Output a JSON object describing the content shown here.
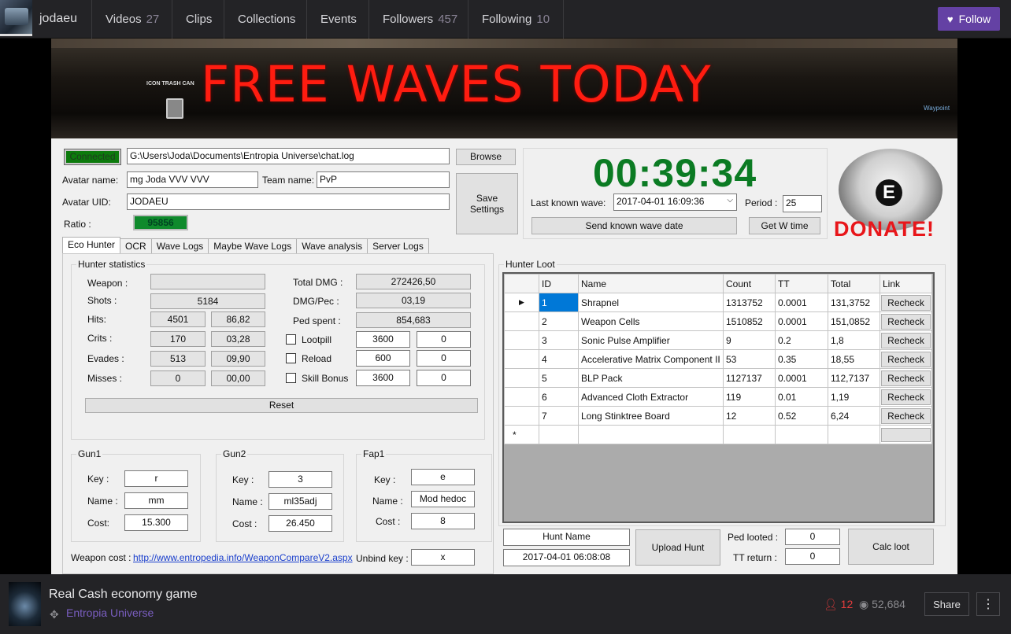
{
  "topbar": {
    "channel": "jodaeu",
    "nav": [
      {
        "label": "Videos",
        "count": "27"
      },
      {
        "label": "Clips",
        "count": ""
      },
      {
        "label": "Collections",
        "count": ""
      },
      {
        "label": "Events",
        "count": ""
      },
      {
        "label": "Followers",
        "count": "457"
      },
      {
        "label": "Following",
        "count": "10"
      }
    ],
    "follow_label": "Follow",
    "accent": "#6441a4"
  },
  "banner": {
    "text": "FREE WAVES TODAY",
    "trash_label": "ICON TRASH CAN",
    "waypoint": "Waypoint"
  },
  "app": {
    "status": "Connected",
    "chat_log_path": "G:\\Users\\Joda\\Documents\\Entropia Universe\\chat.log",
    "browse": "Browse",
    "avatar_name_label": "Avatar name:",
    "avatar_name": "mg Joda VVV VVV",
    "team_name_label": "Team name:",
    "team_name": "PvP",
    "avatar_uid_label": "Avatar UID:",
    "avatar_uid": "JODAEU",
    "ratio_label": "Ratio :",
    "ratio": "95856",
    "save_settings": "Save Settings",
    "timer": "00:39:34",
    "last_wave_label": "Last known wave:",
    "last_wave": "2017-04-01 16:09:36",
    "period_label": "Period :",
    "period": "25",
    "send_wave": "Send known wave date",
    "get_w_time": "Get W time",
    "donate": "DONATE!",
    "donate_logo": "E",
    "tabs": [
      "Eco Hunter",
      "OCR",
      "Wave Logs",
      "Maybe Wave Logs",
      "Wave analysis",
      "Server Logs"
    ],
    "hunter_stats": {
      "title": "Hunter statistics",
      "weapon_label": "Weapon :",
      "weapon": "",
      "shots_label": "Shots :",
      "shots": "5184",
      "hits_label": "Hits:",
      "hits": "4501",
      "hits_pct": "86,82",
      "crits_label": "Crits :",
      "crits": "170",
      "crits_pct": "03,28",
      "evades_label": "Evades :",
      "evades": "513",
      "evades_pct": "09,90",
      "misses_label": "Misses :",
      "misses": "0",
      "misses_pct": "00,00",
      "total_dmg_label": "Total DMG :",
      "total_dmg": "272426,50",
      "dmg_pec_label": "DMG/Pec :",
      "dmg_pec": "03,19",
      "ped_spent_label": "Ped spent :",
      "ped_spent": "854,683",
      "lootpill_label": "Lootpill",
      "lootpill": "3600",
      "lootpill_val": "0",
      "reload_label": "Reload",
      "reload": "600",
      "reload_val": "0",
      "skill_bonus_label": "Skill Bonus",
      "skill_bonus": "3600",
      "skill_bonus_val": "0",
      "reset": "Reset"
    },
    "gun1": {
      "title": "Gun1",
      "key_label": "Key :",
      "key": "r",
      "name_label": "Name :",
      "name": "mm",
      "cost_label": "Cost:",
      "cost": "15.300"
    },
    "gun2": {
      "title": "Gun2",
      "key_label": "Key :",
      "key": "3",
      "name_label": "Name :",
      "name": "ml35adj",
      "cost_label": "Cost :",
      "cost": "26.450"
    },
    "fap1": {
      "title": "Fap1",
      "key_label": "Key :",
      "key": "e",
      "name_label": "Name :",
      "name": "Mod hedoc",
      "cost_label": "Cost :",
      "cost": "8"
    },
    "weapon_cost_label": "Weapon cost :",
    "weapon_cost_link": "http://www.entropedia.info/WeaponCompareV2.aspx",
    "unbind_label": "Unbind key :",
    "unbind_key": "x",
    "hunter_loot": {
      "title": "Hunter Loot",
      "columns": [
        "ID",
        "Name",
        "Count",
        "TT",
        "Total",
        "Link"
      ],
      "rows": [
        {
          "id": "1",
          "name": "Shrapnel",
          "count": "1313752",
          "tt": "0.0001",
          "total": "131,3752",
          "link": "Recheck"
        },
        {
          "id": "2",
          "name": "Weapon Cells",
          "count": "1510852",
          "tt": "0.0001",
          "total": "151,0852",
          "link": "Recheck"
        },
        {
          "id": "3",
          "name": "Sonic Pulse Amplifier",
          "count": "9",
          "tt": "0.2",
          "total": "1,8",
          "link": "Recheck"
        },
        {
          "id": "4",
          "name": "Accelerative Matrix Component II",
          "count": "53",
          "tt": "0.35",
          "total": "18,55",
          "link": "Recheck"
        },
        {
          "id": "5",
          "name": "BLP Pack",
          "count": "1127137",
          "tt": "0.0001",
          "total": "112,7137",
          "link": "Recheck"
        },
        {
          "id": "6",
          "name": "Advanced Cloth Extractor",
          "count": "119",
          "tt": "0.01",
          "total": "1,19",
          "link": "Recheck"
        },
        {
          "id": "7",
          "name": "Long Stinktree Board",
          "count": "12",
          "tt": "0.52",
          "total": "6,24",
          "link": "Recheck"
        }
      ],
      "new_row_marker": "*"
    },
    "hunt_name": "Hunt Name",
    "hunt_date": "2017-04-01 06:08:08",
    "upload_hunt": "Upload Hunt",
    "ped_looted_label": "Ped looted :",
    "ped_looted": "0",
    "tt_return_label": "TT return :",
    "tt_return": "0",
    "calc_loot": "Calc loot"
  },
  "footer": {
    "title": "Real Cash economy game",
    "game": "Entropia Universe",
    "viewers": "12",
    "views": "52,684",
    "share": "Share",
    "more_icon": "⋮"
  }
}
